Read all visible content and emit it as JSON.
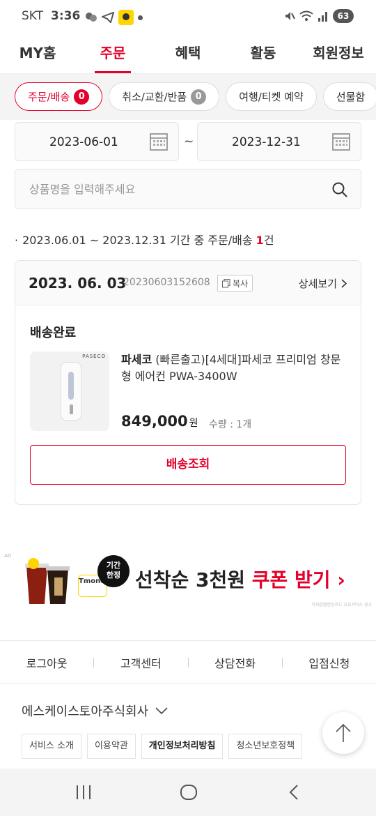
{
  "status_bar": {
    "carrier": "SKT",
    "time": "3:36",
    "battery": "63",
    "icons": [
      "chat-icon",
      "telegram-icon",
      "kakao-icon",
      "dot-icon",
      "mute-icon",
      "wifi-icon",
      "signal-icon"
    ]
  },
  "top_nav": {
    "tabs": [
      {
        "label": "MY홈",
        "active": false
      },
      {
        "label": "주문",
        "active": true
      },
      {
        "label": "혜택",
        "active": false
      },
      {
        "label": "활동",
        "active": false
      },
      {
        "label": "회원정보",
        "active": false
      }
    ]
  },
  "chips": [
    {
      "label": "주문/배송",
      "count": "0",
      "active": true
    },
    {
      "label": "취소/교환/반품",
      "count": "0",
      "active": false
    },
    {
      "label": "여행/티켓 예약",
      "count": "",
      "active": false
    },
    {
      "label": "선물함",
      "count": "",
      "active": false
    }
  ],
  "date_filter": {
    "start": "2023-06-01",
    "separator": "~",
    "end": "2023-12-31"
  },
  "search": {
    "placeholder": "상품명을 입력해주세요"
  },
  "summary": {
    "bullet": "·",
    "prefix": "2023.06.01 ~ 2023.12.31 기간 중 주문/배송 ",
    "count": "1",
    "suffix": "건"
  },
  "order": {
    "date": "2023. 06. 03",
    "order_no": "20230603152608",
    "copy_label": "복사",
    "detail_label": "상세보기",
    "status": "배송완료",
    "product": {
      "image_brand": "PASECO",
      "brand": "파세코",
      "name": " (빠른출고)[4세대]파세코 프리미엄 창문형 에어컨 PWA-3400W",
      "price": "849,000",
      "price_unit": "원",
      "qty": "수량 : 1개"
    },
    "track_label": "배송조회"
  },
  "ad": {
    "mark": "AD",
    "limited": "기간\n한정",
    "tmoney": "Tmoney",
    "text_prefix": "선착순 3천원 ",
    "text_highlight": "쿠폰 받기",
    "arrow": "›",
    "fine_print": "이지샵밸런싱코드 유효서비스 광고"
  },
  "footer_links": [
    "로그아웃",
    "고객센터",
    "상담전화",
    "입점신청"
  ],
  "company": {
    "name": "에스케이스토아주식회사"
  },
  "policies": [
    {
      "label": "서비스 소개",
      "bold": false
    },
    {
      "label": "이용약관",
      "bold": false
    },
    {
      "label": "개인정보처리방침",
      "bold": true
    },
    {
      "label": "청소년보호정책",
      "bold": false
    }
  ],
  "colors": {
    "accent": "#e4002b",
    "text": "#222222",
    "muted": "#888888",
    "border": "#e5e5e5"
  }
}
